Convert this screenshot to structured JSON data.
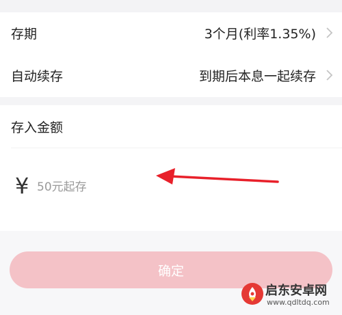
{
  "settings": {
    "term": {
      "label": "存期",
      "value": "3个月(利率1.35%)"
    },
    "renewal": {
      "label": "自动续存",
      "value": "到期后本息一起续存"
    }
  },
  "amount": {
    "title": "存入金额",
    "currency_symbol": "¥",
    "placeholder": "50元起存"
  },
  "confirm": {
    "label": "确定"
  },
  "annotation": {
    "arrow_color": "#e8202a"
  },
  "watermark": {
    "title": "启东安卓网",
    "url": "www.qdltdq.com"
  },
  "colors": {
    "button_bg": "#f4c2c7",
    "watermark_logo": "#e53935"
  }
}
